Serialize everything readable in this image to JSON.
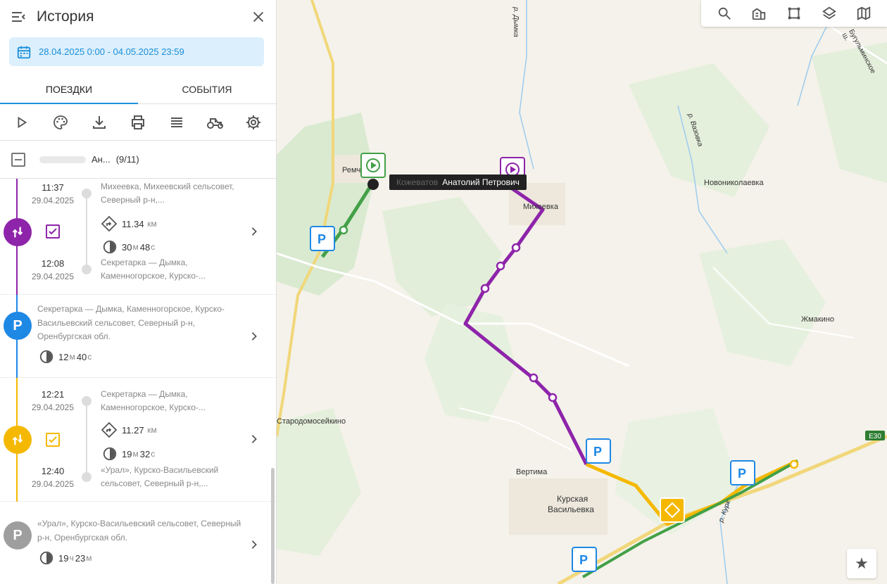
{
  "header": {
    "title": "История"
  },
  "date_range": "28.04.2025 0:00 - 04.05.2025 23:59",
  "tabs": [
    {
      "label": "ПОЕЗДКИ",
      "active": true
    },
    {
      "label": "СОБЫТИЯ",
      "active": false
    }
  ],
  "group": {
    "name": "Ан...",
    "count": "(9/11)"
  },
  "items": [
    {
      "type": "trip",
      "color": "#8e24aa",
      "start_time": "11:37",
      "start_date": "29.04.2025",
      "start_addr": "Михеевка, Михеевский сельсовет, Северный р-н,...",
      "distance": "11.34",
      "distance_unit": "км",
      "duration_min": "30",
      "duration_min_unit": "м",
      "duration_sec": "48",
      "duration_sec_unit": "с",
      "end_time": "12:08",
      "end_date": "29.04.2025",
      "end_addr": "Секретарка — Дымка, Каменногорское, Курско-..."
    },
    {
      "type": "parking",
      "color": "#1e88e5",
      "addr": "Секретарка — Дымка, Каменногорское, Курско-Васильевский сельсовет, Северный р-н, Оренбургская обл.",
      "duration_a": "12",
      "duration_a_unit": "м",
      "duration_b": "40",
      "duration_b_unit": "с"
    },
    {
      "type": "trip",
      "color": "#f5b800",
      "start_time": "12:21",
      "start_date": "29.04.2025",
      "start_addr": "Секретарка — Дымка, Каменногорское, Курско-...",
      "distance": "11.27",
      "distance_unit": "км",
      "duration_min": "19",
      "duration_min_unit": "м",
      "duration_sec": "32",
      "duration_sec_unit": "с",
      "end_time": "12:40",
      "end_date": "29.04.2025",
      "end_addr": "«Урал», Курско-Васильевский сельсовет, Северный р-н,..."
    },
    {
      "type": "parking",
      "color": "#9e9e9e",
      "addr": "«Урал», Курско-Васильевский сельсовет, Северный р-н, Оренбургская обл.",
      "duration_a": "19",
      "duration_a_unit": "ч",
      "duration_b": "23",
      "duration_b_unit": "м"
    }
  ],
  "map": {
    "labels": [
      "р. Дымка",
      "Бугульминское ш.",
      "р. Вазовка",
      "Новониколаевка",
      "Михеевка",
      "Ремч",
      "Жмакино",
      "Стародомосейкино",
      "Вертима",
      "Курская",
      "Васильевка",
      "р. Курк",
      "E30"
    ],
    "tooltip": {
      "hidden_part": "Кожеватов",
      "name": "Анатолий Петрович"
    },
    "parking_letter": "P"
  }
}
